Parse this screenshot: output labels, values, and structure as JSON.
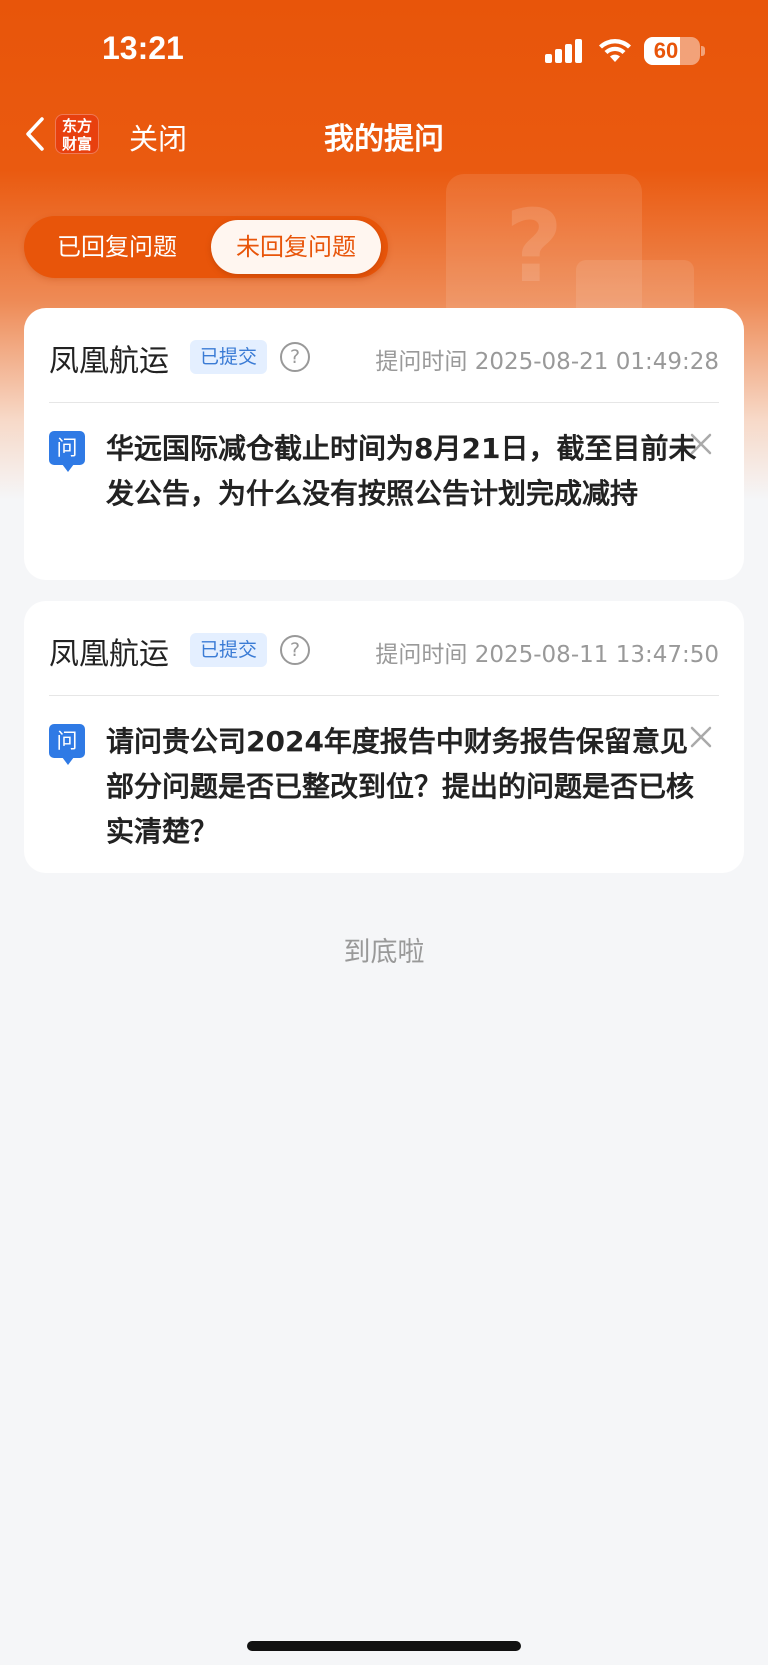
{
  "status_bar": {
    "time": "13:21",
    "battery": "60"
  },
  "nav": {
    "logo_text": "东方财富",
    "close_label": "关闭",
    "title": "我的提问"
  },
  "tabs": [
    {
      "label": "已回复问题",
      "active": false
    },
    {
      "label": "未回复问题",
      "active": true
    }
  ],
  "questions": [
    {
      "company": "凤凰航运",
      "status": "已提交",
      "time": "提问时间 2025-08-21 01:49:28",
      "icon_label": "问",
      "text": "华远国际减仓截止时间为8月21日，截至目前未发公告，为什么没有按照公告计划完成减持"
    },
    {
      "company": "凤凰航运",
      "status": "已提交",
      "time": "提问时间 2025-08-11 13:47:50",
      "icon_label": "问",
      "text": "请问贵公司2024年度报告中财务报告保留意见部分问题是否已整改到位？提出的问题是否已核实清楚？"
    }
  ],
  "footer": {
    "end_text": "到底啦"
  },
  "colors": {
    "brand": "#e8550a",
    "badge_bg": "#e4efff",
    "badge_text": "#3a7bd5",
    "question_icon": "#2f7ae5"
  },
  "icons": [
    "back-icon",
    "help-icon",
    "delete-icon",
    "question-icon",
    "signal-icon",
    "wifi-icon",
    "battery-icon"
  ]
}
